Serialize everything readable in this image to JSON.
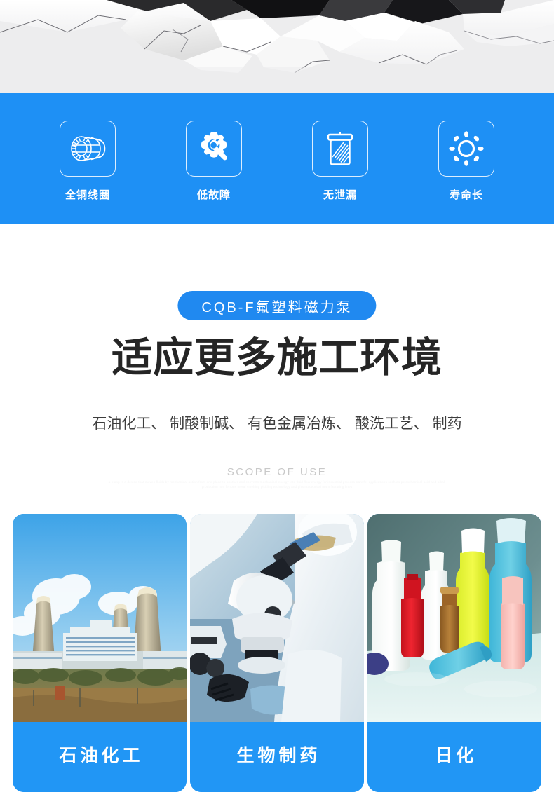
{
  "hero": {
    "graphic": "cracked-wall-graphic",
    "background_color": "#ededee"
  },
  "feature_band": {
    "background_color": "#1e90f5",
    "items": [
      {
        "icon": "motor-coil-icon",
        "label": "全铜线圈"
      },
      {
        "icon": "gear-wrench-icon",
        "label": "低故障"
      },
      {
        "icon": "sealed-container-icon",
        "label": "无泄漏"
      },
      {
        "icon": "sun-icon",
        "label": "寿命长"
      }
    ]
  },
  "scope": {
    "badge": "CQB-F氟塑料磁力泵",
    "badge_color": "#2089f0",
    "headline": "适应更多施工环境",
    "subline": "石油化工、 制酸制碱、 有色金属冶炼、 酸洗工艺、 制药",
    "english_label": "SCOPE OF USE",
    "fine_print": "a pump is a device that moves fluids by mechanical action from one place to another and converts mechanical energy into fluid flow energy for industrial process transfer applications such as petrochemical acid and alkali production non ferrous metal smelting pickling technology and pharmaceutical manufacturing lines"
  },
  "cards": [
    {
      "photo": "cooling-towers-photo",
      "label": "石油化工"
    },
    {
      "photo": "laboratory-microscope-photo",
      "label": "生物制药"
    },
    {
      "photo": "plastic-bottles-photo",
      "label": "日化"
    }
  ],
  "colors": {
    "brand_blue": "#2196f5",
    "band_blue": "#1e90f5",
    "headline_dark": "#252525",
    "scope_gray": "#c9c9c9"
  }
}
